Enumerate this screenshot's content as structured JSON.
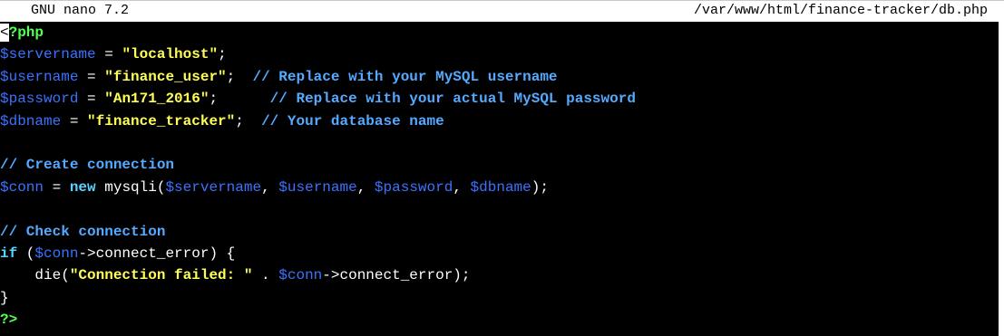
{
  "titlebar": {
    "app_name": "GNU nano 7.2",
    "file_path": "/var/www/html/finance-tracker/db.php"
  },
  "colors": {
    "background": "#000000",
    "variable": "#3a72ff",
    "string": "#ffff55",
    "comment": "#55aaff",
    "php_tag": "#55ff55",
    "keyword": "#55d4ff",
    "plain": "#ffffff"
  },
  "lines": [
    [
      {
        "t": "cursor",
        "text": "<"
      },
      {
        "t": "tag",
        "text": "?php"
      }
    ],
    [
      {
        "t": "var",
        "text": "$servername"
      },
      {
        "t": "plain",
        "text": " = "
      },
      {
        "t": "str",
        "text": "\"localhost\""
      },
      {
        "t": "plain",
        "text": ";"
      }
    ],
    [
      {
        "t": "var",
        "text": "$username"
      },
      {
        "t": "plain",
        "text": " = "
      },
      {
        "t": "str",
        "text": "\"finance_user\""
      },
      {
        "t": "plain",
        "text": ";  "
      },
      {
        "t": "comment",
        "text": "// Replace with your MySQL username"
      }
    ],
    [
      {
        "t": "var",
        "text": "$password"
      },
      {
        "t": "plain",
        "text": " = "
      },
      {
        "t": "str",
        "text": "\"An171_2016\""
      },
      {
        "t": "plain",
        "text": ";      "
      },
      {
        "t": "comment",
        "text": "// Replace with your actual MySQL password"
      }
    ],
    [
      {
        "t": "var",
        "text": "$dbname"
      },
      {
        "t": "plain",
        "text": " = "
      },
      {
        "t": "str",
        "text": "\"finance_tracker\""
      },
      {
        "t": "plain",
        "text": ";  "
      },
      {
        "t": "comment",
        "text": "// Your database name"
      }
    ],
    [],
    [
      {
        "t": "comment",
        "text": "// Create connection"
      }
    ],
    [
      {
        "t": "var",
        "text": "$conn"
      },
      {
        "t": "plain",
        "text": " = "
      },
      {
        "t": "keyword",
        "text": "new"
      },
      {
        "t": "plain",
        "text": " mysqli("
      },
      {
        "t": "var",
        "text": "$servername"
      },
      {
        "t": "plain",
        "text": ", "
      },
      {
        "t": "var",
        "text": "$username"
      },
      {
        "t": "plain",
        "text": ", "
      },
      {
        "t": "var",
        "text": "$password"
      },
      {
        "t": "plain",
        "text": ", "
      },
      {
        "t": "var",
        "text": "$dbname"
      },
      {
        "t": "plain",
        "text": ");"
      }
    ],
    [],
    [
      {
        "t": "comment",
        "text": "// Check connection"
      }
    ],
    [
      {
        "t": "keyword",
        "text": "if"
      },
      {
        "t": "plain",
        "text": " ("
      },
      {
        "t": "var",
        "text": "$conn"
      },
      {
        "t": "plain",
        "text": "->connect_error) {"
      }
    ],
    [
      {
        "t": "plain",
        "text": "    die("
      },
      {
        "t": "str",
        "text": "\"Connection failed: \""
      },
      {
        "t": "plain",
        "text": " . "
      },
      {
        "t": "var",
        "text": "$conn"
      },
      {
        "t": "plain",
        "text": "->connect_error);"
      }
    ],
    [
      {
        "t": "plain",
        "text": "}"
      }
    ],
    [
      {
        "t": "tag",
        "text": "?>"
      }
    ]
  ]
}
